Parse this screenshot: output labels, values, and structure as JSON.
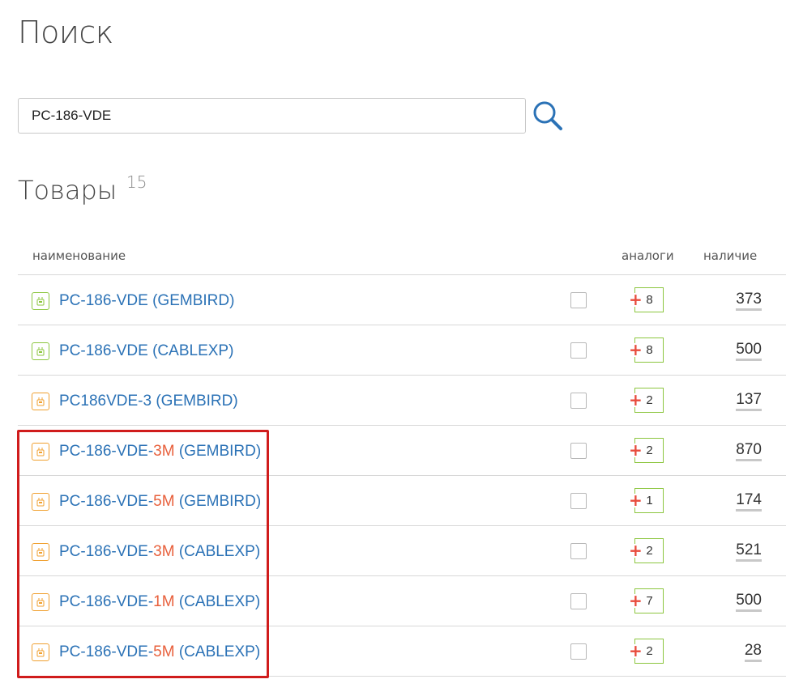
{
  "page": {
    "title": "Поиск"
  },
  "search": {
    "value": "PC-186-VDE"
  },
  "products_section": {
    "title": "Товары",
    "count": "15"
  },
  "table": {
    "headers": {
      "name": "наименование",
      "analogs": "аналоги",
      "stock": "наличие"
    },
    "rows": [
      {
        "icon": "green",
        "prefix": "PC-186-VDE",
        "suffix": "",
        "brand": " (GEMBIRD)",
        "analogs": "8",
        "stock": "373"
      },
      {
        "icon": "green",
        "prefix": "PC-186-VDE",
        "suffix": "",
        "brand": " (CABLEXP)",
        "analogs": "8",
        "stock": "500"
      },
      {
        "icon": "orange",
        "prefix": "PC186VDE-3",
        "suffix": "",
        "brand": " (GEMBIRD)",
        "analogs": "2",
        "stock": "137"
      },
      {
        "icon": "orange",
        "prefix": "PC-186-VDE-",
        "suffix": "3M",
        "brand": " (GEMBIRD)",
        "analogs": "2",
        "stock": "870"
      },
      {
        "icon": "orange",
        "prefix": "PC-186-VDE-",
        "suffix": "5M",
        "brand": " (GEMBIRD)",
        "analogs": "1",
        "stock": "174"
      },
      {
        "icon": "orange",
        "prefix": "PC-186-VDE-",
        "suffix": "3M",
        "brand": " (CABLEXP)",
        "analogs": "2",
        "stock": "521"
      },
      {
        "icon": "orange",
        "prefix": "PC-186-VDE-",
        "suffix": "1M",
        "brand": " (CABLEXP)",
        "analogs": "7",
        "stock": "500"
      },
      {
        "icon": "orange",
        "prefix": "PC-186-VDE-",
        "suffix": "5M",
        "brand": " (CABLEXP)",
        "analogs": "2",
        "stock": "28"
      }
    ]
  },
  "colors": {
    "link": "#2b72b6",
    "highlight_text": "#e8603c",
    "analog_plus": "#e84c3d",
    "analog_border": "#8cc63f",
    "icon_green": "#8cc63f",
    "icon_orange": "#f0a030",
    "annotation_frame": "#d01c1c"
  },
  "icons": {
    "search": "magnifier-icon",
    "product": "robot-product-icon",
    "analog": "plus-icon"
  }
}
